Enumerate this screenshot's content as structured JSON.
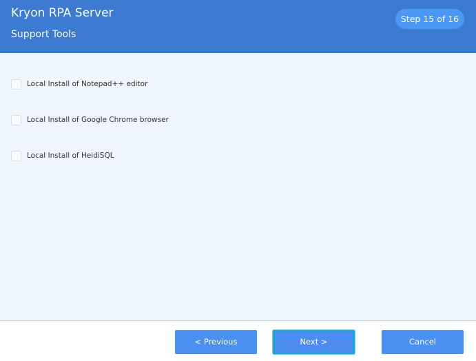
{
  "header": {
    "title": "Kryon RPA Server",
    "subtitle": "Support Tools",
    "step": "Step 15 of 16"
  },
  "options": [
    {
      "label": "Local Install of Notepad++ editor",
      "checked": false
    },
    {
      "label": "Local Install of Google Chrome browser",
      "checked": false
    },
    {
      "label": "Local Install of HeidiSQL",
      "checked": false
    }
  ],
  "footer": {
    "previous_label": "< Previous",
    "next_label": "Next >",
    "cancel_label": "Cancel"
  },
  "colors": {
    "header_bg": "#3b7ad0",
    "badge_bg": "#4b98f5",
    "button_bg": "#4b91f1",
    "focus_ring": "#1aa7d8"
  }
}
